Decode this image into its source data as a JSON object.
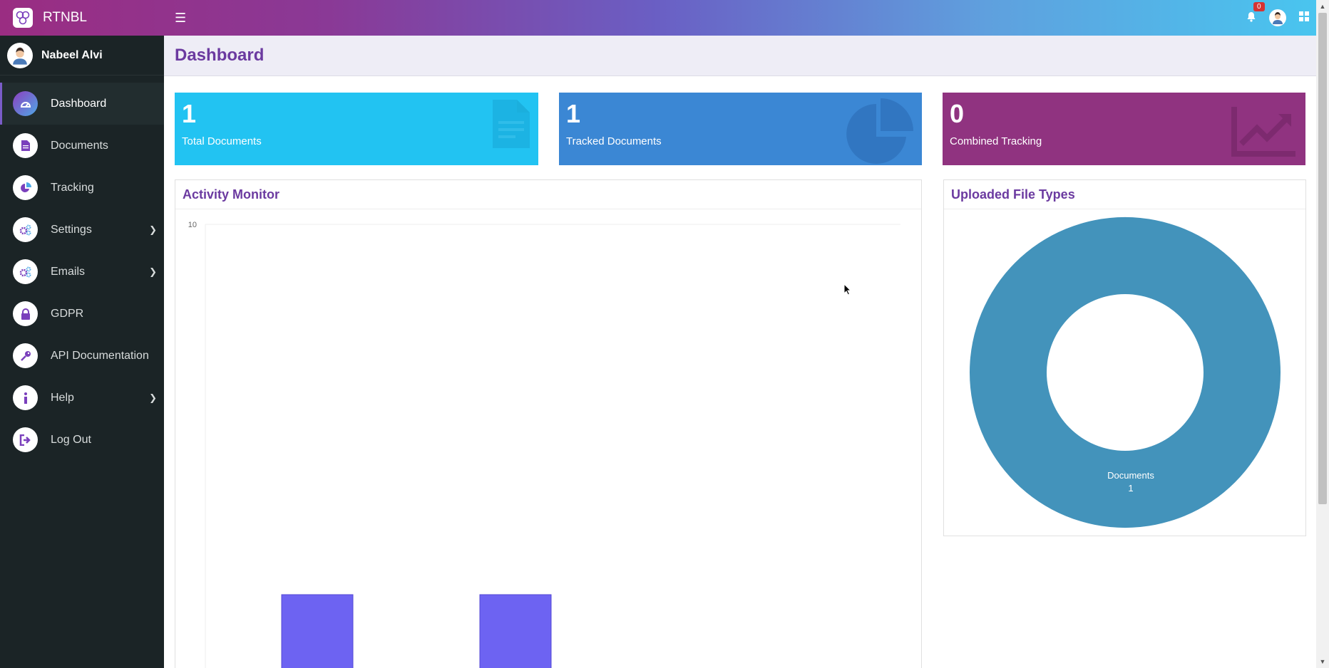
{
  "brand": {
    "name": "RTNBL"
  },
  "notifications": {
    "count": "0"
  },
  "user": {
    "name": "Nabeel Alvi"
  },
  "nav": [
    {
      "label": "Dashboard",
      "icon": "dashboard-gauge-icon",
      "active": true
    },
    {
      "label": "Documents",
      "icon": "document-icon"
    },
    {
      "label": "Tracking",
      "icon": "pie-chart-icon"
    },
    {
      "label": "Settings",
      "icon": "cogs-icon",
      "submenu": true
    },
    {
      "label": "Emails",
      "icon": "cogs-icon",
      "submenu": true
    },
    {
      "label": "GDPR",
      "icon": "lock-icon"
    },
    {
      "label": "API Documentation",
      "icon": "key-icon"
    },
    {
      "label": "Help",
      "icon": "info-icon",
      "submenu": true
    },
    {
      "label": "Log Out",
      "icon": "sign-out-icon"
    }
  ],
  "page": {
    "title": "Dashboard"
  },
  "cards": [
    {
      "value": "1",
      "label": "Total Documents",
      "color": "#22c3f2",
      "icon": "document-icon"
    },
    {
      "value": "1",
      "label": "Tracked Documents",
      "color": "#3b87d4",
      "icon": "pie-chart-icon"
    },
    {
      "value": "0",
      "label": "Combined Tracking",
      "color": "#903380",
      "icon": "trend-chart-icon"
    }
  ],
  "activity": {
    "title": "Activity Monitor"
  },
  "filetypes": {
    "title": "Uploaded File Types"
  },
  "chart_data": [
    {
      "type": "bar",
      "title": "Activity Monitor",
      "ylim": [
        0,
        10
      ],
      "y_tick_labels": [
        "10"
      ],
      "series": [
        {
          "values": [
            2,
            2
          ],
          "color": "#6d63f2"
        }
      ],
      "categories": [
        "",
        ""
      ]
    },
    {
      "type": "pie",
      "donut": true,
      "title": "Uploaded File Types",
      "slices": [
        {
          "label": "Documents",
          "value": 1,
          "color": "#4393bb"
        }
      ]
    }
  ]
}
